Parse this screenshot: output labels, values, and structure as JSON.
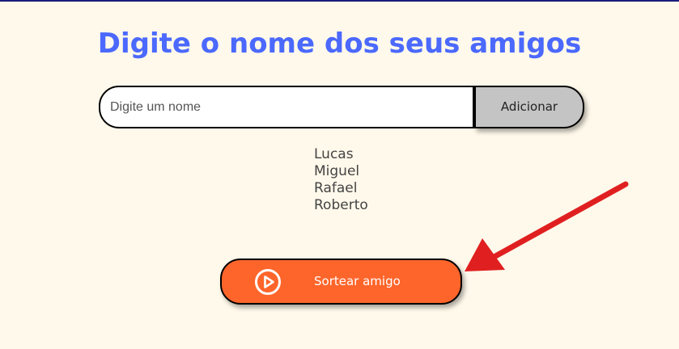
{
  "page": {
    "title": "Digite o nome dos seus amigos"
  },
  "form": {
    "input_placeholder": "Digite um nome",
    "input_value": "",
    "add_button_label": "Adicionar"
  },
  "friends": [
    "Lucas",
    "Miguel",
    "Rafael",
    "Roberto"
  ],
  "draw": {
    "button_label": "Sortear amigo",
    "icon": "play-circle-icon"
  },
  "annotation": {
    "icon": "red-arrow-icon",
    "color": "#e02020"
  },
  "colors": {
    "background": "#fff9eb",
    "title": "#4b69fd",
    "draw_button": "#fe652b",
    "add_button": "#c4c4c4"
  }
}
